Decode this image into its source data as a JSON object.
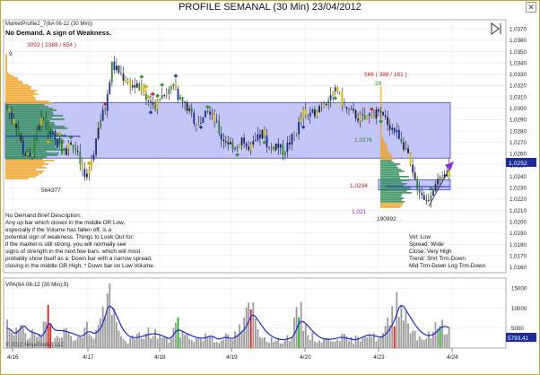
{
  "window": {
    "title": "PROFILE SEMANAL (30 Min)  23/04/2012",
    "close_glyph": "✕"
  },
  "price_panel": {
    "instrument_label": "MarketProfile2_7(6A 06-12 (30 Min))",
    "headline": "No Demand. A sign of Weakness.",
    "profile_left": {
      "stats": "3093 ( 2388 / 654 )",
      "volume_label": "564377",
      "marker": "9"
    },
    "profile_right": {
      "stats": "566 ( 388 / 161 )",
      "volume_label": "190992",
      "marker": "28"
    },
    "level_labels": [
      "1,0276",
      "1,0234",
      "1,021"
    ],
    "description_lines": [
      "No Demand Brief Description:",
      "Any up bar which closes in the middle OR Low,",
      "especially if the Volume has fallen off, is a",
      "potential sign of weakness. Things to Look Out for:",
      "if the market is still strong, you will normally see",
      "signs of strength in the next few bars, which will most",
      "probably show itself as a: Down bar with a narrow spread,",
      " closing in the middle OR High. * Down bar  on Low Volume."
    ],
    "stats_lines": [
      "Vol: Low",
      "Spread: Wide",
      "Close: Very High",
      "Trend:  Shrt Trm-Down",
      "Mid Trm-Down  Lng Trm-Down"
    ],
    "last_price": "1,0252",
    "zone_color": "#b8bcf6"
  },
  "volume_panel": {
    "label": "VPA(6A 06-12 (30 Min),5)",
    "last_value": "5793,41"
  },
  "copyright": "© 2012 NinjaTrader, LLC",
  "chart_data": [
    {
      "type": "candlestick",
      "title": "PROFILE SEMANAL (30 Min)  23/04/2012",
      "x_ticks": [
        "4/16",
        "4/17",
        "4/18",
        "4/19",
        "4/20",
        "4/23",
        "4/24"
      ],
      "y_ticks": [
        "1,0370",
        "1,0360",
        "1,0350",
        "1,0340",
        "1,0330",
        "1,0320",
        "1,0310",
        "1,0300",
        "1,0290",
        "1,0280",
        "1,0270",
        "1,0260",
        "1,0250",
        "1,0240",
        "1,0230",
        "1,0220",
        "1,0210",
        "1,0200",
        "1,0190",
        "1,0180",
        "1,0170",
        "1,0160"
      ],
      "ylim": [
        1.0155,
        1.0378
      ],
      "value_area_high": 1.0305,
      "value_area_low": 1.0256,
      "right_value_area_high": 1.0237,
      "right_value_area_low": 1.0228,
      "close_anchors": [
        [
          0,
          1.03
        ],
        [
          8,
          1.0285
        ],
        [
          14,
          1.0262
        ],
        [
          20,
          1.0255
        ],
        [
          26,
          1.0278
        ],
        [
          32,
          1.0292
        ],
        [
          38,
          1.0276
        ],
        [
          44,
          1.0268
        ],
        [
          50,
          1.0262
        ],
        [
          56,
          1.027
        ],
        [
          62,
          1.0258
        ],
        [
          68,
          1.0238
        ],
        [
          74,
          1.025
        ],
        [
          80,
          1.0285
        ],
        [
          86,
          1.03
        ],
        [
          92,
          1.0338
        ],
        [
          98,
          1.0332
        ],
        [
          104,
          1.0325
        ],
        [
          110,
          1.032
        ],
        [
          116,
          1.0318
        ],
        [
          122,
          1.031
        ],
        [
          128,
          1.03
        ],
        [
          134,
          1.031
        ],
        [
          140,
          1.0314
        ],
        [
          146,
          1.0318
        ],
        [
          152,
          1.0308
        ],
        [
          158,
          1.03
        ],
        [
          164,
          1.029
        ],
        [
          170,
          1.0288
        ],
        [
          176,
          1.0296
        ],
        [
          182,
          1.029
        ],
        [
          188,
          1.0274
        ],
        [
          194,
          1.027
        ],
        [
          200,
          1.0266
        ],
        [
          206,
          1.0274
        ],
        [
          212,
          1.0262
        ],
        [
          218,
          1.027
        ],
        [
          224,
          1.0278
        ],
        [
          230,
          1.0264
        ],
        [
          236,
          1.0268
        ],
        [
          242,
          1.0262
        ],
        [
          248,
          1.027
        ],
        [
          254,
          1.028
        ],
        [
          260,
          1.0296
        ],
        [
          266,
          1.0292
        ],
        [
          272,
          1.03
        ],
        [
          278,
          1.0306
        ],
        [
          284,
          1.0312
        ],
        [
          290,
          1.0316
        ],
        [
          296,
          1.03
        ],
        [
          302,
          1.0296
        ],
        [
          308,
          1.0292
        ],
        [
          314,
          1.029
        ],
        [
          320,
          1.0296
        ],
        [
          326,
          1.0294
        ],
        [
          332,
          1.029
        ],
        [
          338,
          1.0282
        ],
        [
          344,
          1.0276
        ],
        [
          350,
          1.0264
        ],
        [
          356,
          1.024
        ],
        [
          362,
          1.0228
        ],
        [
          368,
          1.0218
        ],
        [
          374,
          1.023
        ],
        [
          380,
          1.0238
        ],
        [
          386,
          1.0244
        ],
        [
          389,
          1.0252
        ]
      ]
    },
    {
      "type": "bar",
      "title": "VPA(6A 06-12 (30 Min),5)",
      "y_ticks": [
        "15000",
        "10000",
        "5000"
      ],
      "ylim": [
        0,
        17500
      ],
      "last_value": 5793.41,
      "volume_anchors": [
        [
          0,
          5000
        ],
        [
          6,
          2500
        ],
        [
          10,
          5500
        ],
        [
          14,
          7000
        ],
        [
          18,
          3000
        ],
        [
          24,
          3500
        ],
        [
          30,
          2200
        ],
        [
          36,
          9500
        ],
        [
          40,
          2800
        ],
        [
          46,
          4500
        ],
        [
          52,
          3800
        ],
        [
          58,
          3200
        ],
        [
          64,
          2400
        ],
        [
          70,
          5200
        ],
        [
          76,
          3000
        ],
        [
          82,
          6500
        ],
        [
          88,
          14500
        ],
        [
          94,
          7000
        ],
        [
          100,
          2500
        ],
        [
          106,
          1800
        ],
        [
          112,
          2500
        ],
        [
          118,
          3200
        ],
        [
          124,
          3800
        ],
        [
          130,
          3600
        ],
        [
          136,
          2600
        ],
        [
          142,
          1800
        ],
        [
          148,
          6200
        ],
        [
          154,
          3500
        ],
        [
          160,
          2700
        ],
        [
          166,
          2200
        ],
        [
          172,
          2500
        ],
        [
          178,
          3500
        ],
        [
          184,
          1500
        ],
        [
          190,
          3200
        ],
        [
          196,
          2000
        ],
        [
          202,
          3800
        ],
        [
          208,
          6000
        ],
        [
          214,
          11000
        ],
        [
          220,
          5000
        ],
        [
          226,
          2800
        ],
        [
          232,
          2000
        ],
        [
          238,
          1800
        ],
        [
          244,
          2200
        ],
        [
          250,
          3200
        ],
        [
          256,
          9500
        ],
        [
          262,
          5000
        ],
        [
          268,
          2700
        ],
        [
          274,
          1800
        ],
        [
          280,
          2000
        ],
        [
          286,
          2400
        ],
        [
          292,
          3000
        ],
        [
          298,
          2200
        ],
        [
          304,
          1800
        ],
        [
          310,
          3000
        ],
        [
          316,
          3800
        ],
        [
          322,
          2700
        ],
        [
          328,
          2500
        ],
        [
          334,
          5500
        ],
        [
          340,
          9500
        ],
        [
          344,
          14200
        ],
        [
          350,
          7500
        ],
        [
          356,
          4500
        ],
        [
          362,
          2800
        ],
        [
          368,
          2500
        ],
        [
          374,
          3800
        ],
        [
          380,
          6500
        ],
        [
          386,
          5200
        ],
        [
          389,
          4200
        ]
      ],
      "highlight_bars": [
        {
          "index": 36,
          "color": "#d22"
        },
        {
          "index": 37,
          "color": "#d22"
        },
        {
          "index": 214,
          "color": "#d22"
        },
        {
          "index": 340,
          "color": "#d22"
        },
        {
          "index": 150,
          "color": "#2a2"
        },
        {
          "index": 256,
          "color": "#2a2"
        },
        {
          "index": 380,
          "color": "#2a2"
        }
      ]
    }
  ]
}
